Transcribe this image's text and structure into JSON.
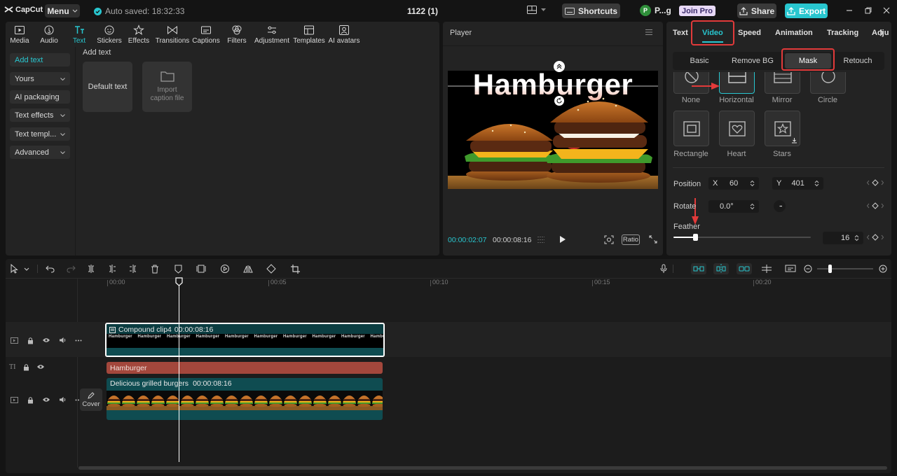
{
  "topbar": {
    "logo": "CapCut",
    "menu": "Menu",
    "autosave": "Auto saved: 18:32:33",
    "project_title": "1122 (1)",
    "shortcuts": "Shortcuts",
    "user": "P...g",
    "user_initial": "P",
    "join_pro": "Join Pro",
    "share": "Share",
    "export": "Export"
  },
  "toolbar": {
    "items": [
      {
        "label": "Media",
        "icon": "media-icon"
      },
      {
        "label": "Audio",
        "icon": "audio-icon"
      },
      {
        "label": "Text",
        "icon": "text-icon",
        "active": true
      },
      {
        "label": "Stickers",
        "icon": "stickers-icon"
      },
      {
        "label": "Effects",
        "icon": "effects-icon"
      },
      {
        "label": "Transitions",
        "icon": "transitions-icon"
      },
      {
        "label": "Captions",
        "icon": "captions-icon"
      },
      {
        "label": "Filters",
        "icon": "filters-icon"
      },
      {
        "label": "Adjustment",
        "icon": "adjustment-icon"
      },
      {
        "label": "Templates",
        "icon": "templates-icon"
      },
      {
        "label": "AI avatars",
        "icon": "ai-avatars-icon"
      }
    ]
  },
  "sidebar": {
    "items": [
      {
        "label": "Add text"
      },
      {
        "label": "Yours"
      },
      {
        "label": "AI packaging"
      },
      {
        "label": "Text effects"
      },
      {
        "label": "Text templ..."
      },
      {
        "label": "Advanced"
      }
    ]
  },
  "content": {
    "heading": "Add text",
    "default_text": "Default text",
    "import_caption": "Import caption file"
  },
  "player": {
    "title": "Player",
    "overlay_text": "Hamburger",
    "current_time": "00:00:02:07",
    "total_time": "00:00:08:16",
    "ratio": "Ratio"
  },
  "inspector": {
    "tabs": [
      "Text",
      "Video",
      "Speed",
      "Animation",
      "Tracking",
      "Adju"
    ],
    "active_tab": "Video",
    "subtabs": [
      "Basic",
      "Remove BG",
      "Mask",
      "Retouch"
    ],
    "active_subtab": "Mask",
    "masks": [
      {
        "label": "None",
        "icon": "none-mask-icon"
      },
      {
        "label": "Horizontal",
        "icon": "horizontal-mask-icon",
        "selected": true
      },
      {
        "label": "Mirror",
        "icon": "mirror-mask-icon"
      },
      {
        "label": "Circle",
        "icon": "circle-mask-icon"
      },
      {
        "label": "Rectangle",
        "icon": "rectangle-mask-icon"
      },
      {
        "label": "Heart",
        "icon": "heart-mask-icon"
      },
      {
        "label": "Stars",
        "icon": "stars-mask-icon"
      }
    ],
    "position_label": "Position",
    "x_label": "X",
    "x_value": "60",
    "y_label": "Y",
    "y_value": "401",
    "rotate_label": "Rotate",
    "rotate_value": "0.0°",
    "feather_label": "Feather",
    "feather_value": "16",
    "feather_fraction": 0.16
  },
  "timeline": {
    "ruler": [
      "00:00",
      "00:05",
      "00:10",
      "00:15",
      "00:20"
    ],
    "compound_clip": {
      "name": "Compound clip4",
      "duration": "00:00:08:16",
      "frame_text": "Hamburger"
    },
    "text_clip": {
      "name": "Hamburger"
    },
    "video_clip": {
      "name": "Delicious grilled burgers",
      "duration": "00:00:08:16"
    },
    "cover_label": "Cover",
    "zoom_fraction": 0.2
  },
  "colors": {
    "accent": "#28c6cf",
    "annotation": "#e23a3a",
    "text_clip": "#a3473c",
    "video_clip": "#0f4c51"
  }
}
